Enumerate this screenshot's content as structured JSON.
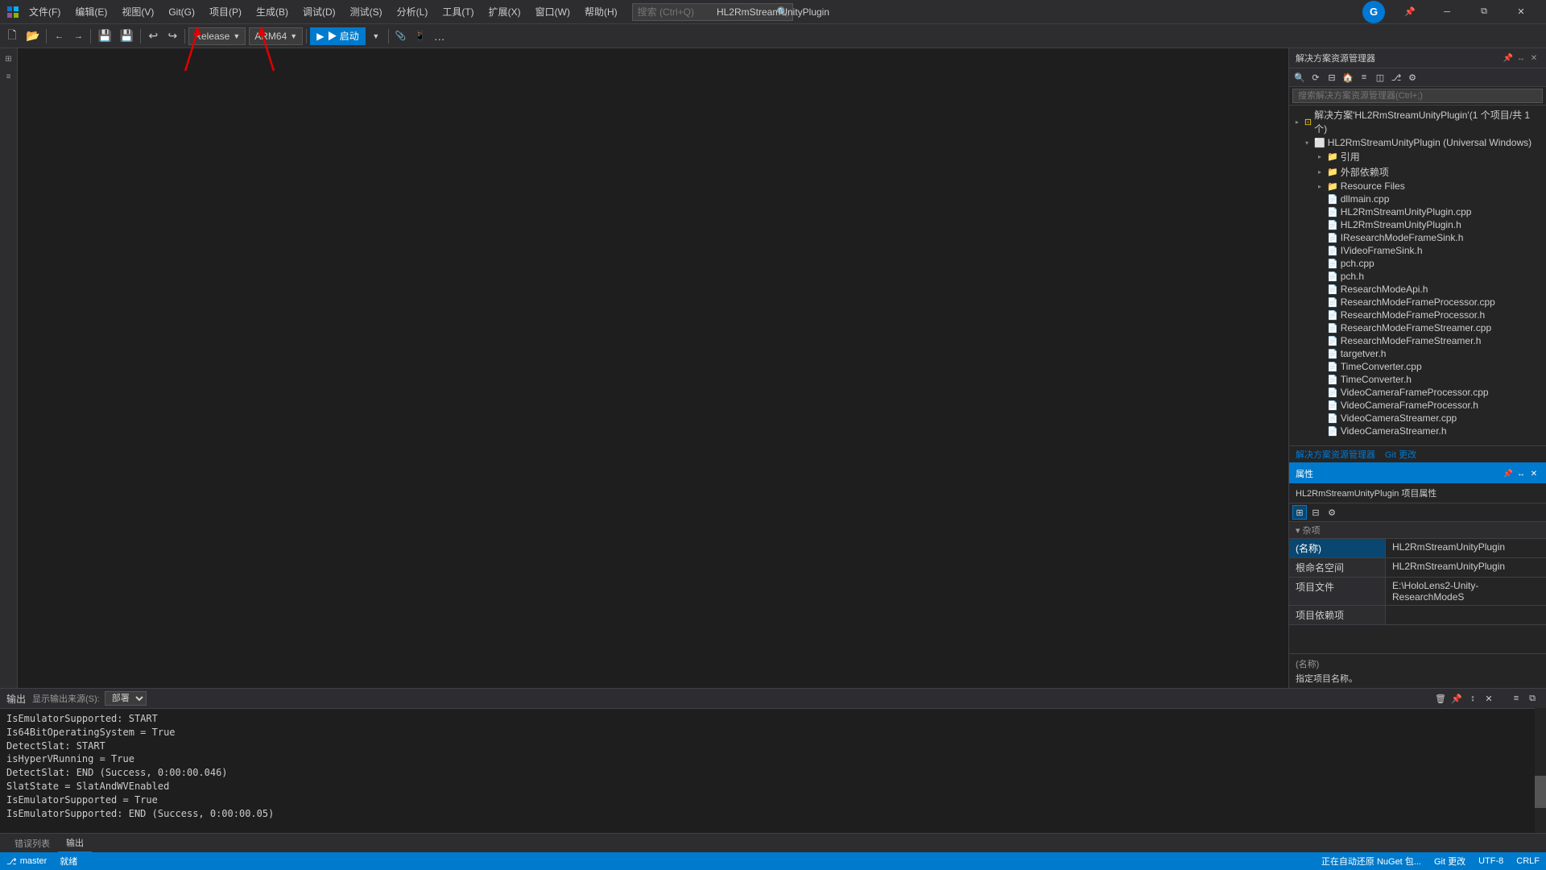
{
  "titlebar": {
    "app_name": "HL2RmStreamUnityPlugin",
    "menu_items": [
      "文件(F)",
      "编辑(E)",
      "视图(V)",
      "Git(G)",
      "项目(P)",
      "生成(B)",
      "调试(D)",
      "测试(S)",
      "分析(L)",
      "工具(T)",
      "扩展(X)",
      "窗口(W)",
      "帮助(H)"
    ],
    "search_placeholder": "搜索 (Ctrl+Q)",
    "user_initial": "G",
    "minimize": "─",
    "restore": "⧉",
    "close": "✕"
  },
  "toolbar": {
    "config_label": "Release",
    "platform_label": "ARM64",
    "run_label": "▶ 启动",
    "run_dropdown": "▾"
  },
  "solution_explorer": {
    "panel_title": "解决方案资源管理器",
    "search_placeholder": "搜索解决方案资源管理器(Ctrl+;)",
    "solution_label": "解决方案'HL2RmStreamUnityPlugin'(1 个项目/共 1 个)",
    "project_label": "HL2RmStreamUnityPlugin (Universal Windows)",
    "tree_items": [
      {
        "level": 1,
        "label": "引用",
        "icon": "📁",
        "expanded": false
      },
      {
        "level": 1,
        "label": "外部依赖项",
        "icon": "📁",
        "expanded": false
      },
      {
        "level": 1,
        "label": "Resource Files",
        "icon": "📁",
        "expanded": false
      },
      {
        "level": 1,
        "label": "dllmain.cpp",
        "icon": "📄",
        "expanded": false
      },
      {
        "level": 1,
        "label": "HL2RmStreamUnityPlugin.cpp",
        "icon": "📄",
        "expanded": false
      },
      {
        "level": 1,
        "label": "HL2RmStreamUnityPlugin.h",
        "icon": "📄",
        "expanded": false
      },
      {
        "level": 1,
        "label": "IResearchModeFrameSink.h",
        "icon": "📄",
        "expanded": false
      },
      {
        "level": 1,
        "label": "IVideoFrameSink.h",
        "icon": "📄",
        "expanded": false
      },
      {
        "level": 1,
        "label": "pch.cpp",
        "icon": "📄",
        "expanded": false
      },
      {
        "level": 1,
        "label": "pch.h",
        "icon": "📄",
        "expanded": false
      },
      {
        "level": 1,
        "label": "ResearchModeApi.h",
        "icon": "📄",
        "expanded": false
      },
      {
        "level": 1,
        "label": "ResearchModeFrameProcessor.cpp",
        "icon": "📄",
        "expanded": false
      },
      {
        "level": 1,
        "label": "ResearchModeFrameProcessor.h",
        "icon": "📄",
        "expanded": false
      },
      {
        "level": 1,
        "label": "ResearchModeFrameStreamer.cpp",
        "icon": "📄",
        "expanded": false
      },
      {
        "level": 1,
        "label": "ResearchModeFrameStreamer.h",
        "icon": "📄",
        "expanded": false
      },
      {
        "level": 1,
        "label": "targetver.h",
        "icon": "📄",
        "expanded": false
      },
      {
        "level": 1,
        "label": "TimeConverter.cpp",
        "icon": "📄",
        "expanded": false
      },
      {
        "level": 1,
        "label": "TimeConverter.h",
        "icon": "📄",
        "expanded": false
      },
      {
        "level": 1,
        "label": "VideoCameraFrameProcessor.cpp",
        "icon": "📄",
        "expanded": false
      },
      {
        "level": 1,
        "label": "VideoCameraFrameProcessor.h",
        "icon": "📄",
        "expanded": false
      },
      {
        "level": 1,
        "label": "VideoCameraStreamer.cpp",
        "icon": "📄",
        "expanded": false
      },
      {
        "level": 1,
        "label": "VideoCameraStreamer.h",
        "icon": "📄",
        "expanded": false
      }
    ],
    "footer_links": [
      "解决方案资源管理器",
      "Git 更改"
    ]
  },
  "properties_panel": {
    "header_title": "属性",
    "project_title": "HL2RmStreamUnityPlugin 项目属性",
    "category_label": "杂项",
    "rows": [
      {
        "name": "(名称)",
        "value": "HL2RmStreamUnityPlugin",
        "selected": true
      },
      {
        "name": "根命名空间",
        "value": "HL2RmStreamUnityPlugin",
        "selected": false
      },
      {
        "name": "项目文件",
        "value": "E:\\HoloLens2-Unity-ResearchModeS",
        "selected": false
      },
      {
        "name": "项目依赖项",
        "value": "",
        "selected": false
      }
    ],
    "desc_label": "(名称)",
    "desc_text": "指定项目名称。"
  },
  "output_panel": {
    "title": "输出",
    "filter_label": "显示输出来源(S):",
    "filter_value": "部署",
    "content_lines": [
      "IsEmulatorSupported: START",
      "    Is64BitOperatingSystem = True",
      "DetectSlat: START",
      "    isHyperVRunning = True",
      "DetectSlat: END (Success, 0:00:00.046)",
      "    SlatState = SlatAndWVEnabled",
      "    IsEmulatorSupported = True",
      "IsEmulatorSupported: END (Success, 0:00:00.05)"
    ]
  },
  "bottom_tabs": [
    {
      "label": "错误列表",
      "active": false
    },
    {
      "label": "输出",
      "active": true
    }
  ],
  "status_bar": {
    "status_text": "就绪",
    "right_items": [
      "正在自动还原 NuGet 包...",
      "Git 更改"
    ]
  },
  "colors": {
    "accent": "#007acc",
    "toolbar_bg": "#2d2d30",
    "editor_bg": "#1e1e1e",
    "selected_bg": "#094771",
    "red_arrow": "#e00000"
  }
}
